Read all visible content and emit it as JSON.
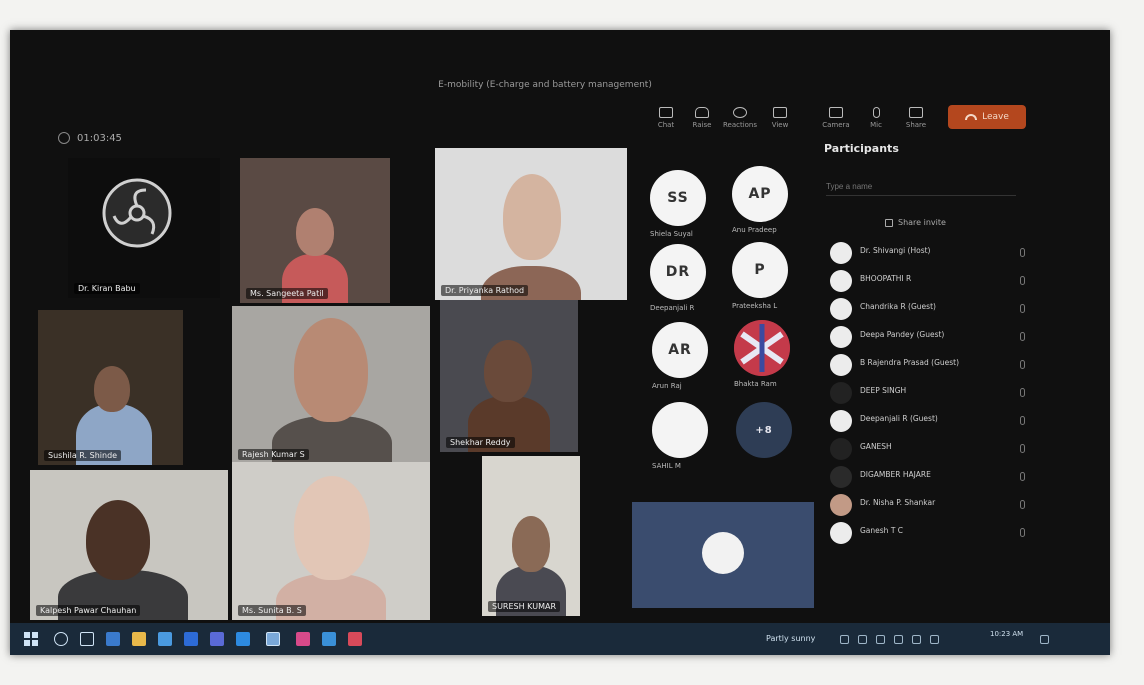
{
  "meeting": {
    "title": "E-mobility (E-charge and battery management)",
    "timer": "01:03:45"
  },
  "toolbar": {
    "items": [
      "Chat",
      "Raise",
      "Reactions",
      "View",
      "Camera",
      "Mic",
      "Share"
    ],
    "leave_label": "Leave"
  },
  "video_tiles": [
    {
      "name": "Dr. Kiran Babu"
    },
    {
      "name": "Ms. Sangeeta Patil"
    },
    {
      "name": "Dr. Priyanka Rathod"
    },
    {
      "name": "Sushila R. Shinde"
    },
    {
      "name": "Rajesh Kumar S"
    },
    {
      "name": "Shekhar Reddy"
    },
    {
      "name": "Kalpesh Pawar Chauhan"
    },
    {
      "name": "Ms. Sunita B. S"
    },
    {
      "name": "SURESH KUMAR"
    }
  ],
  "avatars": [
    {
      "initials": "SS",
      "name": "Shiela Suyal"
    },
    {
      "initials": "AP",
      "name": "Anu Pradeep"
    },
    {
      "initials": "DR",
      "name": "Deepanjali R"
    },
    {
      "initials": "P",
      "name": "Prateeksha L"
    },
    {
      "initials": "AR",
      "name": "Arun Raj"
    },
    {
      "initials": "",
      "name": "Bhakta Ram"
    },
    {
      "initials": "",
      "name": "SAHIL M"
    },
    {
      "initials": "+8",
      "name": ""
    }
  ],
  "participants_panel": {
    "title": "Participants",
    "search_placeholder": "Type a name",
    "share_invite": "Share invite",
    "list": [
      "Dr. Shivangi (Host)",
      "BHOOPATHI R",
      "Chandrika R (Guest)",
      "Deepa Pandey (Guest)",
      "B Rajendra Prasad (Guest)",
      "DEEP SINGH",
      "Deepanjali R (Guest)",
      "GANESH",
      "DIGAMBER HAJARE",
      "Dr. Nisha P. Shankar",
      "Ganesh T C"
    ]
  },
  "taskbar": {
    "weather": "Partly sunny",
    "time": "10:23 AM"
  },
  "colors": {
    "screen_bg": "#101010",
    "leave_button": "#b4471e",
    "taskbar_bg": "#1a2a3a"
  }
}
